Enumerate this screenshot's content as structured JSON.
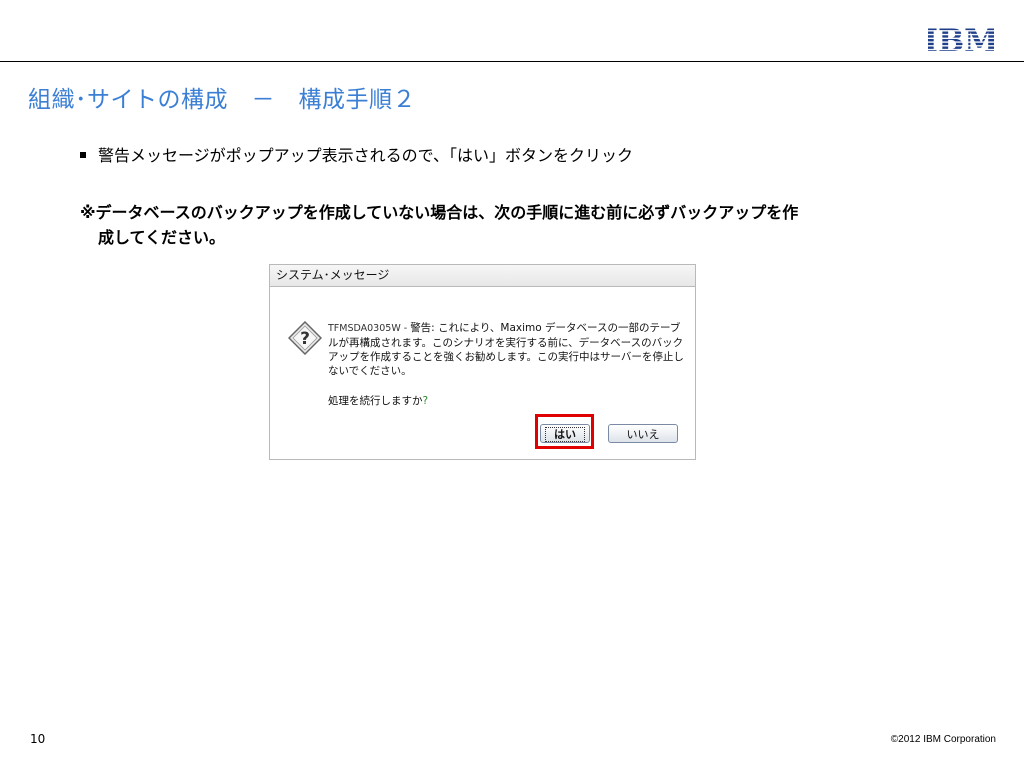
{
  "header": {
    "logo_text": "IBM"
  },
  "slide": {
    "title": "組織･サイトの構成　－　構成手順２",
    "bullet": "警告メッセージがポップアップ表示されるので、「はい」ボタンをクリック",
    "note_line1": "※データベースのバックアップを作成していない場合は、次の手順に進む前に必ずバックアップを作",
    "note_line2": "成してください。"
  },
  "dialog": {
    "title": "システム･メッセージ",
    "message_code": "TFMSDA0305W - ",
    "message_body": "警告: これにより、Maximo データベースの一部のテーブルが再構成されます。このシナリオを実行する前に、データベースのバックアップを作成することを強くお勧めします。この実行中はサーバーを停止しないでください。",
    "question": "処理を続行しますか",
    "question_mark": "?",
    "yes_label": "はい",
    "no_label": "いいえ",
    "icon": "warning-question-icon"
  },
  "footer": {
    "page_number": "10",
    "copyright": "©2012 IBM Corporation"
  },
  "colors": {
    "title": "#3b7fd4",
    "highlight": "#e00000",
    "logo": "#1f3f8a"
  }
}
